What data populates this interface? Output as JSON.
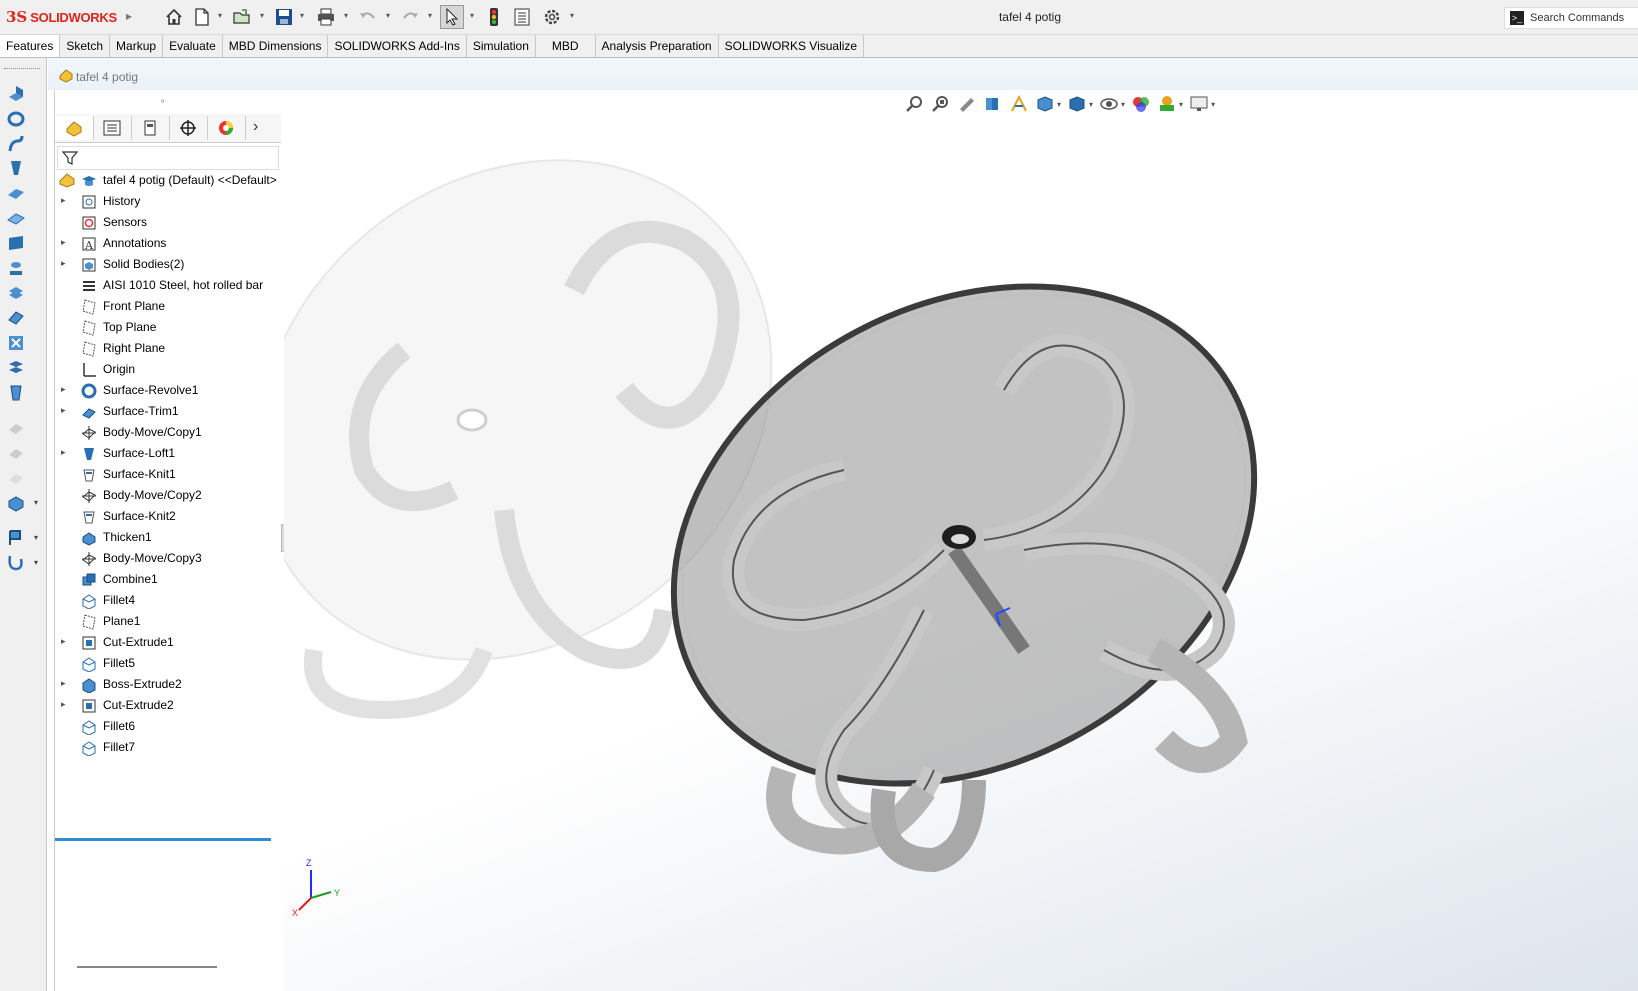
{
  "app": {
    "brand_ds": "3S",
    "brand_name": "SOLIDWORKS",
    "document_title": "tafel 4 potig"
  },
  "search": {
    "placeholder": "Search Commands"
  },
  "tabs": [
    {
      "label": "Features",
      "active": true
    },
    {
      "label": "Sketch"
    },
    {
      "label": "Markup"
    },
    {
      "label": "Evaluate"
    },
    {
      "label": "MBD Dimensions"
    },
    {
      "label": "SOLIDWORKS Add-Ins"
    },
    {
      "label": "Simulation"
    },
    {
      "label": "MBD"
    },
    {
      "label": "Analysis Preparation"
    },
    {
      "label": "SOLIDWORKS Visualize"
    }
  ],
  "feature_manager": {
    "breadcrumb": "tafel 4 potig",
    "root": "tafel 4 potig (Default) <<Default>",
    "items": [
      {
        "label": "History",
        "expandable": true,
        "icon": "history-icon"
      },
      {
        "label": "Sensors",
        "expandable": false,
        "icon": "sensor-icon"
      },
      {
        "label": "Annotations",
        "expandable": true,
        "icon": "annotation-icon"
      },
      {
        "label": "Solid Bodies(2)",
        "expandable": true,
        "icon": "solid-bodies-icon"
      },
      {
        "label": "AISI 1010 Steel, hot rolled bar",
        "expandable": false,
        "icon": "material-icon"
      },
      {
        "label": "Front Plane",
        "expandable": false,
        "icon": "plane-icon"
      },
      {
        "label": "Top Plane",
        "expandable": false,
        "icon": "plane-icon"
      },
      {
        "label": "Right Plane",
        "expandable": false,
        "icon": "plane-icon"
      },
      {
        "label": "Origin",
        "expandable": false,
        "icon": "origin-icon"
      },
      {
        "label": "Surface-Revolve1",
        "expandable": true,
        "icon": "surface-revolve-icon"
      },
      {
        "label": "Surface-Trim1",
        "expandable": true,
        "icon": "surface-trim-icon"
      },
      {
        "label": "Body-Move/Copy1",
        "expandable": false,
        "icon": "body-move-icon"
      },
      {
        "label": "Surface-Loft1",
        "expandable": true,
        "icon": "surface-loft-icon"
      },
      {
        "label": "Surface-Knit1",
        "expandable": false,
        "icon": "surface-knit-icon"
      },
      {
        "label": "Body-Move/Copy2",
        "expandable": false,
        "icon": "body-move-icon"
      },
      {
        "label": "Surface-Knit2",
        "expandable": false,
        "icon": "surface-knit-icon"
      },
      {
        "label": "Thicken1",
        "expandable": false,
        "icon": "thicken-icon"
      },
      {
        "label": "Body-Move/Copy3",
        "expandable": false,
        "icon": "body-move-icon"
      },
      {
        "label": "Combine1",
        "expandable": false,
        "icon": "combine-icon"
      },
      {
        "label": "Fillet4",
        "expandable": false,
        "icon": "fillet-icon"
      },
      {
        "label": "Plane1",
        "expandable": false,
        "icon": "plane-icon"
      },
      {
        "label": "Cut-Extrude1",
        "expandable": true,
        "icon": "cut-extrude-icon"
      },
      {
        "label": "Fillet5",
        "expandable": false,
        "icon": "fillet-icon"
      },
      {
        "label": "Boss-Extrude2",
        "expandable": true,
        "icon": "boss-extrude-icon"
      },
      {
        "label": "Cut-Extrude2",
        "expandable": true,
        "icon": "cut-extrude-icon"
      },
      {
        "label": "Fillet6",
        "expandable": false,
        "icon": "fillet-icon"
      },
      {
        "label": "Fillet7",
        "expandable": false,
        "icon": "fillet-icon"
      }
    ]
  },
  "triad": {
    "x": "X",
    "y": "Y",
    "z": "Z"
  },
  "colors": {
    "accent": "#2e8bd6",
    "brand": "#e2231a"
  }
}
